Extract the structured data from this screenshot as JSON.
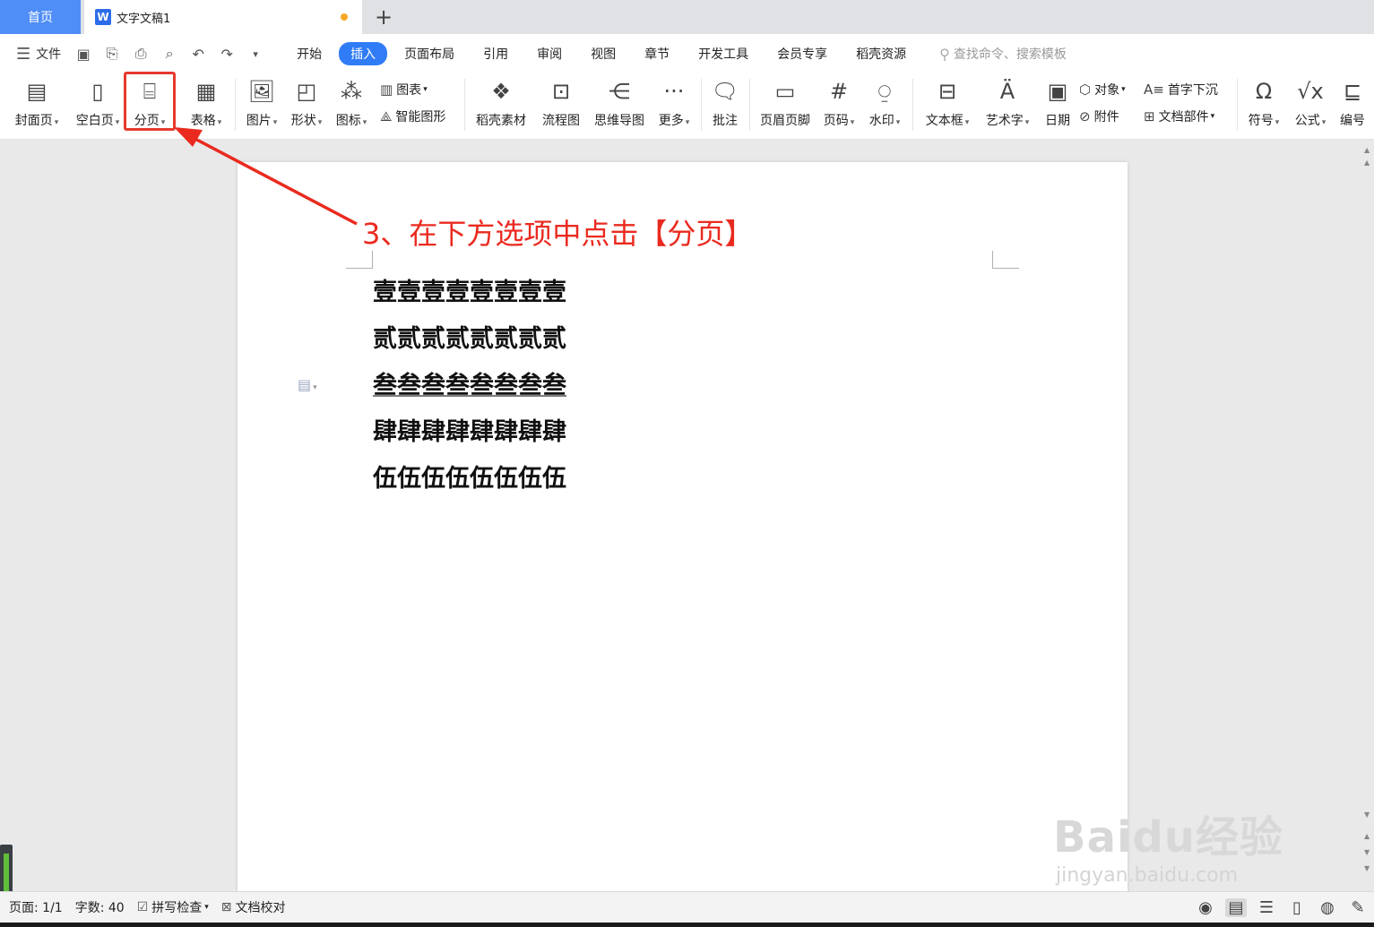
{
  "tabs": {
    "home": "首页",
    "doc_title": "文字文稿1",
    "add": "+"
  },
  "menu": {
    "file": "文件",
    "tabs": [
      "开始",
      "插入",
      "页面布局",
      "引用",
      "审阅",
      "视图",
      "章节",
      "开发工具",
      "会员专享",
      "稻壳资源"
    ],
    "active_tab": "插入",
    "search_placeholder": "查找命令、搜索模板"
  },
  "ribbon": {
    "cover": "封面页",
    "blank": "空白页",
    "page_break": "分页",
    "table": "表格",
    "picture": "图片",
    "shape": "形状",
    "icon": "图标",
    "chart": "图表",
    "smart_art": "智能图形",
    "docer_material": "稻壳素材",
    "flowchart": "流程图",
    "mindmap": "思维导图",
    "more": "更多",
    "comment": "批注",
    "header_footer": "页眉页脚",
    "page_number": "页码",
    "watermark": "水印",
    "textbox": "文本框",
    "wordart": "艺术字",
    "date": "日期",
    "object": "对象",
    "drop_cap": "首字下沉",
    "attachment": "附件",
    "doc_parts": "文档部件",
    "symbol": "符号",
    "formula": "公式",
    "numbering": "编号"
  },
  "annotation": "3、在下方选项中点击【分页】",
  "document": {
    "lines": [
      "壹壹壹壹壹壹壹壹",
      "贰贰贰贰贰贰贰贰",
      "叁叁叁叁叁叁叁叁",
      "肆肆肆肆肆肆肆肆",
      "伍伍伍伍伍伍伍伍"
    ]
  },
  "status": {
    "page": "页面: 1/1",
    "word_count": "字数: 40",
    "spell_check": "拼写检查",
    "proofread": "文档校对"
  },
  "watermark": {
    "main": "Baidu经验",
    "sub": "jingyan.baidu.com"
  },
  "colors": {
    "accent": "#2f7cf6",
    "annotation_red": "#ea2a1f",
    "home_tab": "#4f8df7"
  }
}
